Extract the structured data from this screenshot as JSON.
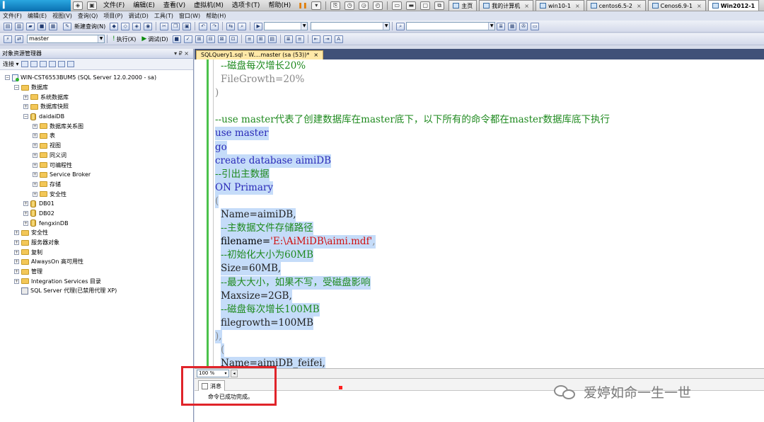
{
  "host_bar": {
    "menus": [
      "文件(F)",
      "编辑(E)",
      "查看(V)",
      "虚拟机(M)",
      "选项卡(T)",
      "帮助(H)"
    ],
    "tabs": [
      {
        "label": "主页",
        "active": false
      },
      {
        "label": "我的计算机",
        "active": false
      },
      {
        "label": "win10-1",
        "active": false
      },
      {
        "label": "centos6.5-2",
        "active": false
      },
      {
        "label": "Cenos6.9-1",
        "active": false
      },
      {
        "label": "Win2012-1",
        "active": true
      }
    ]
  },
  "menu_bar": [
    "文件(F)",
    "编辑(E)",
    "视图(V)",
    "查询(Q)",
    "项目(P)",
    "调试(D)",
    "工具(T)",
    "窗口(W)",
    "帮助(H)"
  ],
  "toolbar1": {
    "new_query": "新建查询(N)"
  },
  "toolbar2": {
    "database": "master",
    "execute": "执行(X)",
    "debug": "调试(D)"
  },
  "object_explorer": {
    "title": "对象资源管理器",
    "pin": "▾ ₽ ×",
    "connect": "连接 ▾",
    "tree": [
      {
        "label": "WIN-CST6553BUM5 (SQL Server 12.0.2000 - sa)",
        "level": 0,
        "icon": "server-icon",
        "expander": "−"
      },
      {
        "label": "数据库",
        "level": 1,
        "icon": "folder-icon",
        "expander": "−"
      },
      {
        "label": "系统数据库",
        "level": 2,
        "icon": "folder-icon",
        "expander": "+"
      },
      {
        "label": "数据库快照",
        "level": 2,
        "icon": "folder-icon",
        "expander": "+"
      },
      {
        "label": "daidaiDB",
        "level": 2,
        "icon": "database-icon",
        "expander": "−"
      },
      {
        "label": "数据库关系图",
        "level": 3,
        "icon": "folder-icon",
        "expander": "+"
      },
      {
        "label": "表",
        "level": 3,
        "icon": "folder-icon",
        "expander": "+"
      },
      {
        "label": "视图",
        "level": 3,
        "icon": "folder-icon",
        "expander": "+"
      },
      {
        "label": "同义词",
        "level": 3,
        "icon": "folder-icon",
        "expander": "+"
      },
      {
        "label": "可编程性",
        "level": 3,
        "icon": "folder-icon",
        "expander": "+"
      },
      {
        "label": "Service Broker",
        "level": 3,
        "icon": "folder-icon",
        "expander": "+"
      },
      {
        "label": "存储",
        "level": 3,
        "icon": "folder-icon",
        "expander": "+"
      },
      {
        "label": "安全性",
        "level": 3,
        "icon": "folder-icon",
        "expander": "+"
      },
      {
        "label": "DB01",
        "level": 2,
        "icon": "database-icon",
        "expander": "+"
      },
      {
        "label": "DB02",
        "level": 2,
        "icon": "database-icon",
        "expander": "+"
      },
      {
        "label": "fengxinDB",
        "level": 2,
        "icon": "database-icon",
        "expander": "+"
      },
      {
        "label": "安全性",
        "level": 1,
        "icon": "folder-icon",
        "expander": "+"
      },
      {
        "label": "服务器对象",
        "level": 1,
        "icon": "folder-icon",
        "expander": "+"
      },
      {
        "label": "复制",
        "level": 1,
        "icon": "folder-icon",
        "expander": "+"
      },
      {
        "label": "AlwaysOn 高可用性",
        "level": 1,
        "icon": "folder-icon",
        "expander": "+"
      },
      {
        "label": "管理",
        "level": 1,
        "icon": "folder-icon",
        "expander": "+"
      },
      {
        "label": "Integration Services 目录",
        "level": 1,
        "icon": "folder-icon",
        "expander": "+"
      },
      {
        "label": "SQL Server 代理(已禁用代理 XP)",
        "level": 1,
        "icon": "agent-icon",
        "expander": ""
      }
    ]
  },
  "editor": {
    "tab_label": "SQLQuery1.sql - W....master (sa (53))*",
    "tab_close": "×",
    "lines": [
      {
        "indent": 1,
        "text": "--磁盘每次增长20%",
        "kind": "cm",
        "sel": false
      },
      {
        "indent": 1,
        "text": "FileGrowth=20%",
        "kind": "gy",
        "sel": false
      },
      {
        "indent": 0,
        "text": ")",
        "kind": "gy",
        "sel": false
      },
      {
        "indent": 0,
        "text": "",
        "kind": "df",
        "sel": false
      },
      {
        "indent": 0,
        "text": "--use master代表了创建数据库在master底下，以下所有的命令都在master数据库底下执行",
        "kind": "cm",
        "sel": false
      },
      {
        "indent": 0,
        "text": "use master",
        "kind": "kw",
        "sel": true
      },
      {
        "indent": 0,
        "text": "go",
        "kind": "kw",
        "sel": true
      },
      {
        "indent": 0,
        "text": "create database aimiDB",
        "kind": "kw",
        "sel": true
      },
      {
        "indent": 0,
        "text": "--引出主数据",
        "kind": "cm",
        "sel": true
      },
      {
        "indent": 0,
        "text": "ON Primary",
        "kind": "kw",
        "sel": true
      },
      {
        "indent": 0,
        "text": "(",
        "kind": "gy",
        "sel": true
      },
      {
        "indent": 1,
        "text": "Name=aimiDB,",
        "kind": "df",
        "sel": true
      },
      {
        "indent": 1,
        "text": "--主数据文件存储路径",
        "kind": "cm",
        "sel": true
      },
      {
        "indent": 1,
        "text": "filename='E:\\AiMiDB\\aimi.mdf',",
        "kind": "fn",
        "sel": true
      },
      {
        "indent": 1,
        "text": "--初始化大小为60MB",
        "kind": "cm",
        "sel": true
      },
      {
        "indent": 1,
        "text": "Size=60MB,",
        "kind": "df",
        "sel": true
      },
      {
        "indent": 1,
        "text": "--最大大小，如果不写，受磁盘影响",
        "kind": "cm",
        "sel": true
      },
      {
        "indent": 1,
        "text": "Maxsize=2GB,",
        "kind": "df",
        "sel": true
      },
      {
        "indent": 1,
        "text": "--磁盘每次增长100MB",
        "kind": "cm",
        "sel": true
      },
      {
        "indent": 1,
        "text": "filegrowth=100MB",
        "kind": "df",
        "sel": true
      },
      {
        "indent": 0,
        "text": "),",
        "kind": "gy",
        "sel": true
      },
      {
        "indent": 1,
        "text": "(",
        "kind": "gy",
        "sel": true
      },
      {
        "indent": 1,
        "text": "Name=aimiDB_feifei,",
        "kind": "df",
        "sel": true
      }
    ]
  },
  "zoom": {
    "value": "100 %"
  },
  "results": {
    "tab_label": "消息",
    "message": "命令已成功完成。"
  },
  "watermark": {
    "text": "爱婷如命一生一世"
  },
  "colors": {
    "highlight_border": "#e0242a",
    "selection": "#c5dcf9",
    "comment": "#1f8a1f",
    "keyword": "#2a2ab8",
    "string": "#d01010"
  }
}
